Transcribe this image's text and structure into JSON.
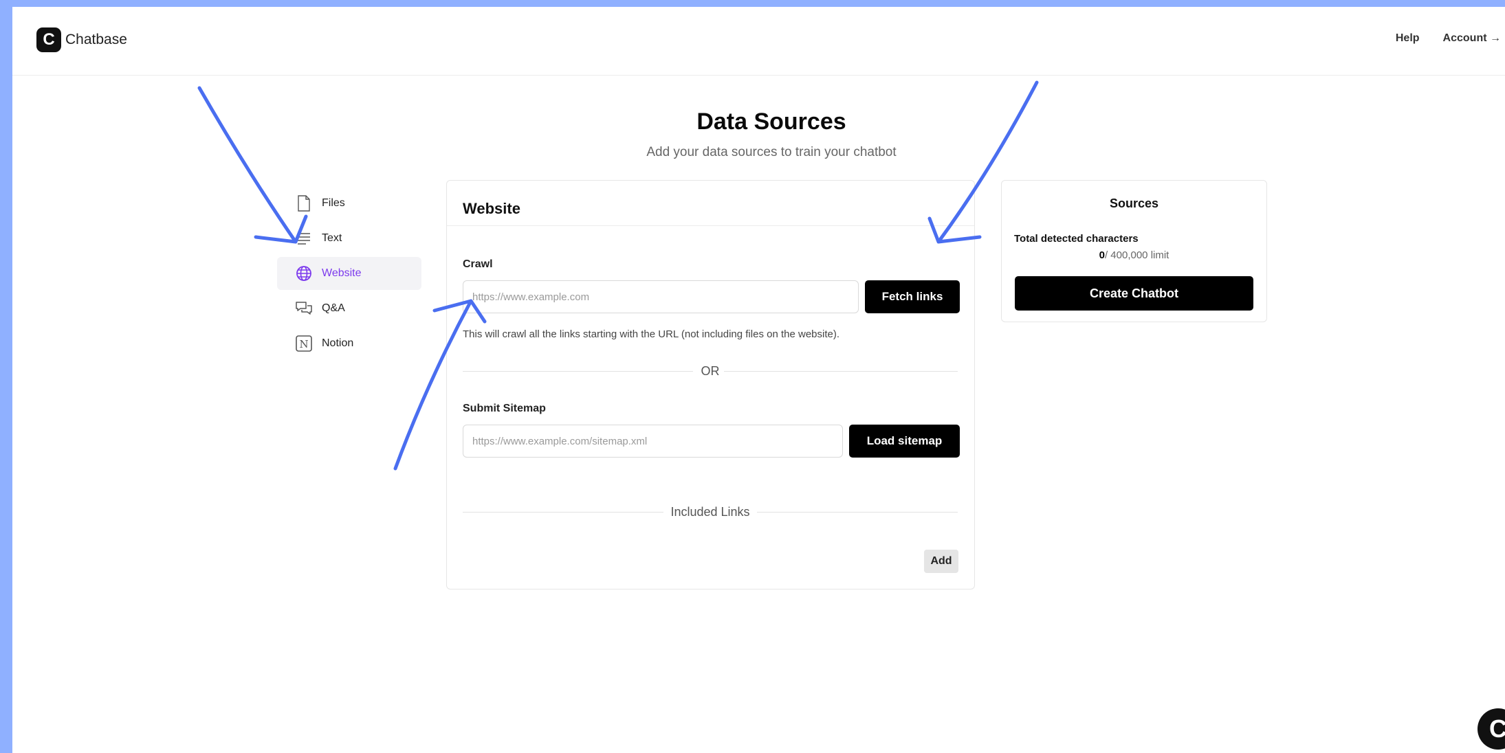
{
  "header": {
    "logo_letter": "C",
    "app_name": "Chatbase",
    "nav": [
      "Help",
      "Account →"
    ]
  },
  "page": {
    "title": "Data Sources",
    "subtitle": "Add your data sources to train your chatbot"
  },
  "sidebar": {
    "items": [
      {
        "label": "Files",
        "icon": "file-icon"
      },
      {
        "label": "Text",
        "icon": "text-lines-icon"
      },
      {
        "label": "Website",
        "icon": "globe-icon",
        "active": true
      },
      {
        "label": "Q&A",
        "icon": "chat-bubbles-icon"
      },
      {
        "label": "Notion",
        "icon": "notion-icon"
      }
    ]
  },
  "website_card": {
    "title": "Website",
    "crawl_label": "Crawl",
    "crawl_placeholder": "https://www.example.com",
    "fetch_button": "Fetch links",
    "crawl_hint": "This will crawl all the links starting with the URL (not including files on the website).",
    "or_text": "OR",
    "sitemap_label": "Submit Sitemap",
    "sitemap_placeholder": "https://www.example.com/sitemap.xml",
    "sitemap_button": "Load sitemap",
    "included_links_label": "Included Links",
    "add_button": "Add"
  },
  "sources_card": {
    "title": "Sources",
    "total_label": "Total detected characters",
    "count": "0",
    "limit_text": "/ 400,000 limit",
    "create_button": "Create Chatbot"
  },
  "widget": {
    "letter": "C"
  },
  "colors": {
    "accent": "#7c3aed",
    "annotation": "#4a6ef0",
    "background_frame": "#8fb0ff"
  }
}
